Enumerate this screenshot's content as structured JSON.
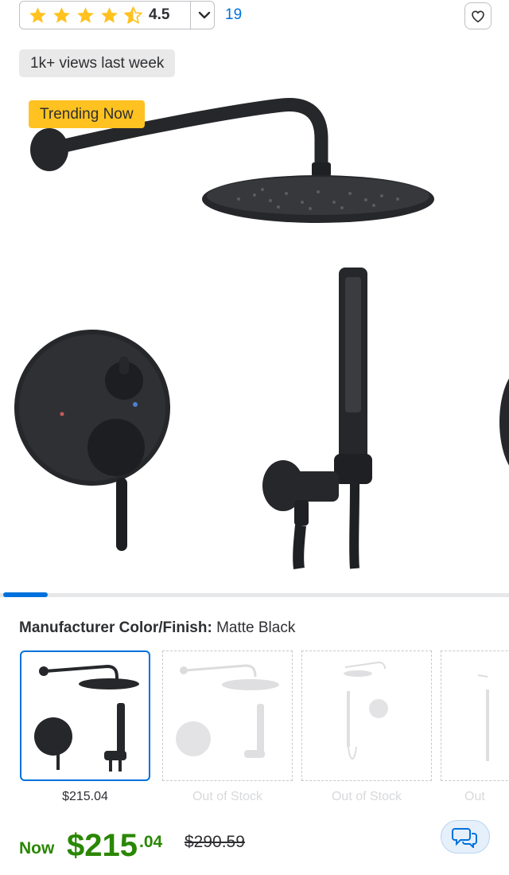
{
  "rating": {
    "value": "4.5",
    "stars": 4.5,
    "review_count": "19"
  },
  "badges": {
    "views": "1k+ views last week",
    "trending": "Trending Now"
  },
  "carousel": {
    "progress": 0.09
  },
  "variant": {
    "label": "Manufacturer Color/Finish:",
    "value": "Matte Black",
    "options": [
      {
        "caption": "$215.04",
        "selected": true
      },
      {
        "caption": "Out of Stock",
        "selected": false
      },
      {
        "caption": "Out of Stock",
        "selected": false
      },
      {
        "caption": "Out",
        "selected": false
      }
    ]
  },
  "price": {
    "now_label": "Now",
    "dollars": "$215",
    "cents": ".04",
    "was": "$290.59"
  },
  "colors": {
    "accent": "#0071dc",
    "price_green": "#2a8703",
    "trending": "#ffc220",
    "star": "#ffc220"
  },
  "icons": {
    "favorite": "heart-icon",
    "chat": "chat-bubbles-icon",
    "dropdown": "chevron-down-icon"
  }
}
